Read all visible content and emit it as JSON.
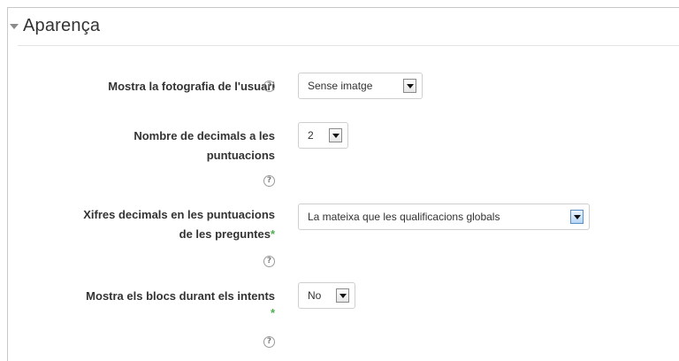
{
  "section": {
    "title": "Aparença"
  },
  "fields": [
    {
      "label": "Mostra la fotografia de l'usuari",
      "value": "Sense imatge",
      "required": false
    },
    {
      "label_line1": "Nombre de decimals a les",
      "label_line2": "puntuacions",
      "value": "2",
      "required": false
    },
    {
      "label_line1": "Xifres decimals en les puntuacions",
      "label_line2": "de les preguntes",
      "value": "La mateixa que les qualificacions globals",
      "required": true
    },
    {
      "label": "Mostra els blocs durant els intents",
      "value": "No",
      "required": true
    }
  ],
  "icons": {
    "help": "help-icon",
    "collapse": "collapse-arrow-icon"
  },
  "symbols": {
    "help_glyph": "?",
    "required_mark": "*"
  },
  "colors": {
    "required": "#4caf50",
    "help_border": "#9a9a9a"
  }
}
